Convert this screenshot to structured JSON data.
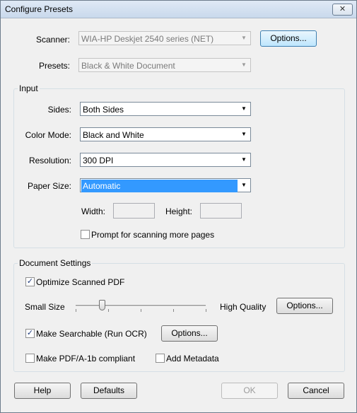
{
  "window": {
    "title": "Configure Presets",
    "close_glyph": "✕"
  },
  "scanner": {
    "label": "Scanner:",
    "value": "WIA-HP Deskjet 2540 series (NET)",
    "options_label": "Options..."
  },
  "presets": {
    "label": "Presets:",
    "value": "Black & White Document"
  },
  "input": {
    "group_label": "Input",
    "sides": {
      "label": "Sides:",
      "value": "Both Sides"
    },
    "color_mode": {
      "label": "Color Mode:",
      "value": "Black and White"
    },
    "resolution": {
      "label": "Resolution:",
      "value": "300 DPI"
    },
    "paper_size": {
      "label": "Paper Size:",
      "value": "Automatic"
    },
    "width_label": "Width:",
    "height_label": "Height:",
    "prompt_more": {
      "label": "Prompt for scanning more pages",
      "checked": false
    }
  },
  "document_settings": {
    "group_label": "Document Settings",
    "optimize": {
      "label": "Optimize Scanned PDF",
      "checked": true
    },
    "quality": {
      "min_label": "Small Size",
      "max_label": "High Quality",
      "level": 0.2
    },
    "quality_options_label": "Options...",
    "searchable": {
      "label": "Make Searchable (Run OCR)",
      "checked": true
    },
    "ocr_options_label": "Options...",
    "pdfa": {
      "label": "Make PDF/A-1b compliant",
      "checked": false
    },
    "metadata": {
      "label": "Add Metadata",
      "checked": false
    }
  },
  "footer": {
    "help": "Help",
    "defaults": "Defaults",
    "ok": "OK",
    "cancel": "Cancel"
  },
  "icons": {
    "dropdown": "chevron-down-icon",
    "check": "checkmark-icon"
  }
}
